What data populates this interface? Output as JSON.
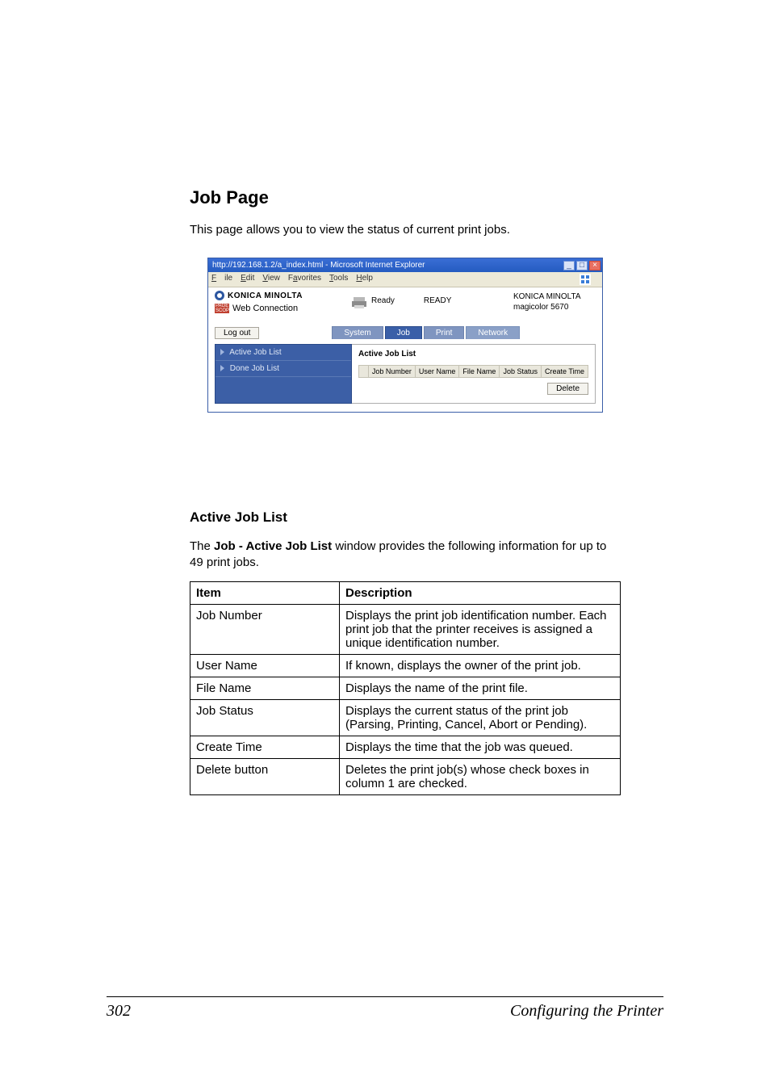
{
  "page_title": "Job Page",
  "intro_para": "This page allows you to view the status of current print jobs.",
  "screenshot": {
    "window_title": "http://192.168.1.2/a_index.html - Microsoft Internet Explorer",
    "menu": {
      "file": "File",
      "edit": "Edit",
      "view": "View",
      "favorites": "Favorites",
      "tools": "Tools",
      "help": "Help"
    },
    "brand_name": "KONICA MINOLTA",
    "ps_label": "PAGE SCOPE",
    "wc_label": "Web Connection",
    "status_small": "Ready",
    "status_big": "READY",
    "model_line1": "KONICA MINOLTA",
    "model_line2": "magicolor 5670",
    "logout": "Log out",
    "tabs": {
      "system": "System",
      "job": "Job",
      "print": "Print",
      "network": "Network"
    },
    "side": {
      "active": "Active Job List",
      "done": "Done Job List"
    },
    "panel_title": "Active Job List",
    "cols": {
      "jobnum": "Job Number",
      "uname": "User Name",
      "fname": "File Name",
      "jstatus": "Job Status",
      "ctime": "Create Time"
    },
    "delete_btn": "Delete"
  },
  "section_title": "Active Job List",
  "section_intro_pre": "The ",
  "section_intro_bold": "Job - Active Job List",
  "section_intro_post": " window provides the following information for up to 49 print jobs.",
  "table_headers": {
    "item": "Item",
    "desc": "Description"
  },
  "rows": [
    {
      "item": "Job Number",
      "desc": "Displays the print job identification number. Each print job that the printer receives is assigned a unique identification number."
    },
    {
      "item": "User Name",
      "desc": "If known, displays the owner of the print job."
    },
    {
      "item": "File Name",
      "desc": "Displays the name of the print file."
    },
    {
      "item": "Job Status",
      "desc": "Displays the current status of the print job (Parsing, Printing, Cancel, Abort or Pending)."
    },
    {
      "item": "Create Time",
      "desc": "Displays the time that the job was queued."
    },
    {
      "item": "Delete button",
      "desc": "Deletes the print job(s) whose check boxes in column 1 are checked."
    }
  ],
  "footer": {
    "page_no": "302",
    "title": "Configuring the Printer"
  }
}
